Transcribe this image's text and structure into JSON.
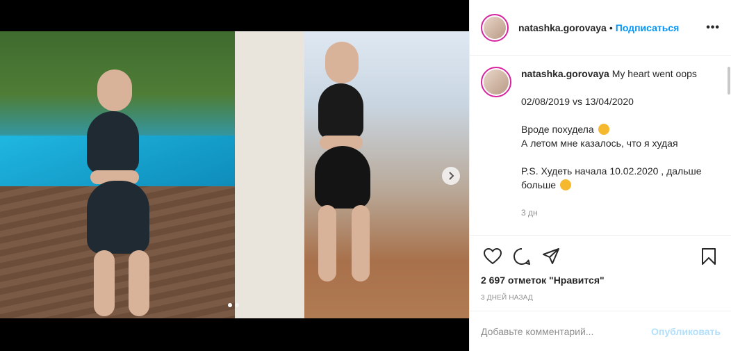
{
  "post": {
    "username": "natashka.gorovaya",
    "bullet": "•",
    "follow_label": "Подписаться",
    "more_label": "•••"
  },
  "caption": {
    "username": "natashka.gorovaya",
    "line1": "My heart went oops",
    "line2": "02/08/2019 vs 13/04/2020",
    "line3": "Вроде похудела",
    "line4": "А летом мне казалось, что я худая",
    "line5": "P.S. Худеть начала 10.02.2020 , дальше больше",
    "time": "3 дн"
  },
  "stats": {
    "likes": "2 697 отметок \"Нравится\"",
    "ago": "3 ДНЕЙ НАЗАД"
  },
  "comment": {
    "placeholder": "Добавьте комментарий...",
    "publish_label": "Опубликовать"
  },
  "icons": {
    "like": "heart-icon",
    "comment": "comment-icon",
    "share": "share-icon",
    "save": "bookmark-icon",
    "next": "chevron-right-icon"
  },
  "carousel": {
    "current": 1,
    "total": 2
  },
  "colors": {
    "accent": "#0095f6",
    "publish_disabled": "#b2dffc",
    "avatar_ring": "#d6249f"
  }
}
